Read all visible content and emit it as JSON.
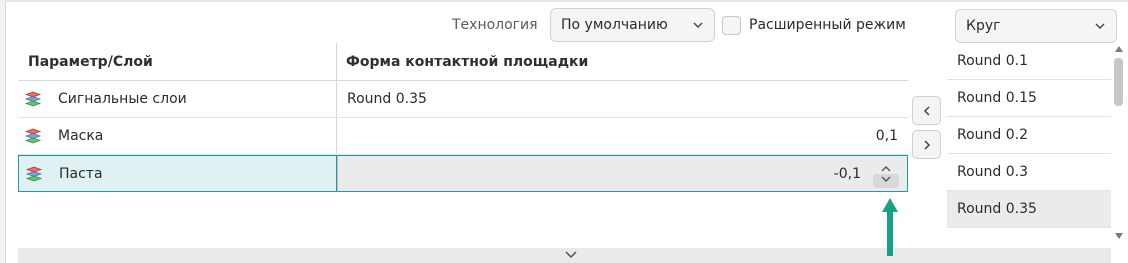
{
  "toolbar": {
    "technology_label": "Технология",
    "technology_value": "По умолчанию",
    "advanced_label": "Расширенный режим",
    "advanced_checked": false,
    "shape_value": "Круг"
  },
  "table": {
    "headers": [
      "Параметр/Слой",
      "Форма контактной площадки"
    ],
    "rows": [
      {
        "layer": "Сигнальные слои",
        "value": "Round 0.35"
      },
      {
        "layer": "Маска",
        "value": "0,1"
      },
      {
        "layer": "Паста",
        "value": "-0,1"
      }
    ],
    "selected_row": "Паста"
  },
  "shape_list": {
    "items": [
      "Round 0.1",
      "Round 0.15",
      "Round 0.2",
      "Round 0.3",
      "Round 0.35"
    ],
    "selected": "Round 0.35"
  },
  "icons": {
    "layer_icon": "layers-stack-icon",
    "prev": "chevron-left-icon",
    "next": "chevron-right-icon",
    "expand": "chevron-down-icon",
    "spin": "spinner-updown-icon",
    "annotation": "arrow-up-icon"
  },
  "colors": {
    "selection_border": "#1f9aa0",
    "selection_fill": "#dff1f2",
    "annotation_arrow": "#15a284"
  }
}
